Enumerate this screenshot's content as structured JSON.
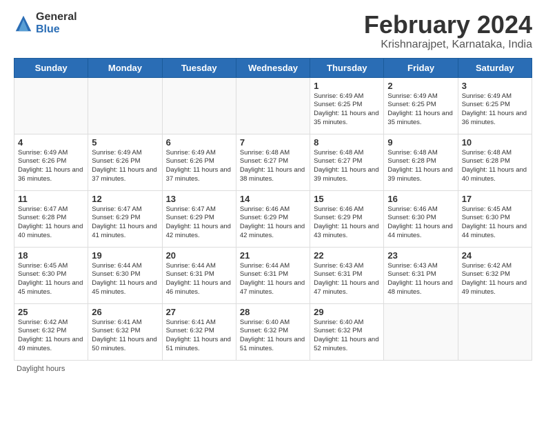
{
  "logo": {
    "general": "General",
    "blue": "Blue"
  },
  "title": "February 2024",
  "location": "Krishnarajpet, Karnataka, India",
  "days_of_week": [
    "Sunday",
    "Monday",
    "Tuesday",
    "Wednesday",
    "Thursday",
    "Friday",
    "Saturday"
  ],
  "footer": "Daylight hours",
  "weeks": [
    [
      {
        "day": "",
        "info": ""
      },
      {
        "day": "",
        "info": ""
      },
      {
        "day": "",
        "info": ""
      },
      {
        "day": "",
        "info": ""
      },
      {
        "day": "1",
        "info": "Sunrise: 6:49 AM\nSunset: 6:25 PM\nDaylight: 11 hours and 35 minutes."
      },
      {
        "day": "2",
        "info": "Sunrise: 6:49 AM\nSunset: 6:25 PM\nDaylight: 11 hours and 35 minutes."
      },
      {
        "day": "3",
        "info": "Sunrise: 6:49 AM\nSunset: 6:25 PM\nDaylight: 11 hours and 36 minutes."
      }
    ],
    [
      {
        "day": "4",
        "info": "Sunrise: 6:49 AM\nSunset: 6:26 PM\nDaylight: 11 hours and 36 minutes."
      },
      {
        "day": "5",
        "info": "Sunrise: 6:49 AM\nSunset: 6:26 PM\nDaylight: 11 hours and 37 minutes."
      },
      {
        "day": "6",
        "info": "Sunrise: 6:49 AM\nSunset: 6:26 PM\nDaylight: 11 hours and 37 minutes."
      },
      {
        "day": "7",
        "info": "Sunrise: 6:48 AM\nSunset: 6:27 PM\nDaylight: 11 hours and 38 minutes."
      },
      {
        "day": "8",
        "info": "Sunrise: 6:48 AM\nSunset: 6:27 PM\nDaylight: 11 hours and 39 minutes."
      },
      {
        "day": "9",
        "info": "Sunrise: 6:48 AM\nSunset: 6:28 PM\nDaylight: 11 hours and 39 minutes."
      },
      {
        "day": "10",
        "info": "Sunrise: 6:48 AM\nSunset: 6:28 PM\nDaylight: 11 hours and 40 minutes."
      }
    ],
    [
      {
        "day": "11",
        "info": "Sunrise: 6:47 AM\nSunset: 6:28 PM\nDaylight: 11 hours and 40 minutes."
      },
      {
        "day": "12",
        "info": "Sunrise: 6:47 AM\nSunset: 6:29 PM\nDaylight: 11 hours and 41 minutes."
      },
      {
        "day": "13",
        "info": "Sunrise: 6:47 AM\nSunset: 6:29 PM\nDaylight: 11 hours and 42 minutes."
      },
      {
        "day": "14",
        "info": "Sunrise: 6:46 AM\nSunset: 6:29 PM\nDaylight: 11 hours and 42 minutes."
      },
      {
        "day": "15",
        "info": "Sunrise: 6:46 AM\nSunset: 6:29 PM\nDaylight: 11 hours and 43 minutes."
      },
      {
        "day": "16",
        "info": "Sunrise: 6:46 AM\nSunset: 6:30 PM\nDaylight: 11 hours and 44 minutes."
      },
      {
        "day": "17",
        "info": "Sunrise: 6:45 AM\nSunset: 6:30 PM\nDaylight: 11 hours and 44 minutes."
      }
    ],
    [
      {
        "day": "18",
        "info": "Sunrise: 6:45 AM\nSunset: 6:30 PM\nDaylight: 11 hours and 45 minutes."
      },
      {
        "day": "19",
        "info": "Sunrise: 6:44 AM\nSunset: 6:30 PM\nDaylight: 11 hours and 45 minutes."
      },
      {
        "day": "20",
        "info": "Sunrise: 6:44 AM\nSunset: 6:31 PM\nDaylight: 11 hours and 46 minutes."
      },
      {
        "day": "21",
        "info": "Sunrise: 6:44 AM\nSunset: 6:31 PM\nDaylight: 11 hours and 47 minutes."
      },
      {
        "day": "22",
        "info": "Sunrise: 6:43 AM\nSunset: 6:31 PM\nDaylight: 11 hours and 47 minutes."
      },
      {
        "day": "23",
        "info": "Sunrise: 6:43 AM\nSunset: 6:31 PM\nDaylight: 11 hours and 48 minutes."
      },
      {
        "day": "24",
        "info": "Sunrise: 6:42 AM\nSunset: 6:32 PM\nDaylight: 11 hours and 49 minutes."
      }
    ],
    [
      {
        "day": "25",
        "info": "Sunrise: 6:42 AM\nSunset: 6:32 PM\nDaylight: 11 hours and 49 minutes."
      },
      {
        "day": "26",
        "info": "Sunrise: 6:41 AM\nSunset: 6:32 PM\nDaylight: 11 hours and 50 minutes."
      },
      {
        "day": "27",
        "info": "Sunrise: 6:41 AM\nSunset: 6:32 PM\nDaylight: 11 hours and 51 minutes."
      },
      {
        "day": "28",
        "info": "Sunrise: 6:40 AM\nSunset: 6:32 PM\nDaylight: 11 hours and 51 minutes."
      },
      {
        "day": "29",
        "info": "Sunrise: 6:40 AM\nSunset: 6:32 PM\nDaylight: 11 hours and 52 minutes."
      },
      {
        "day": "",
        "info": ""
      },
      {
        "day": "",
        "info": ""
      }
    ]
  ]
}
